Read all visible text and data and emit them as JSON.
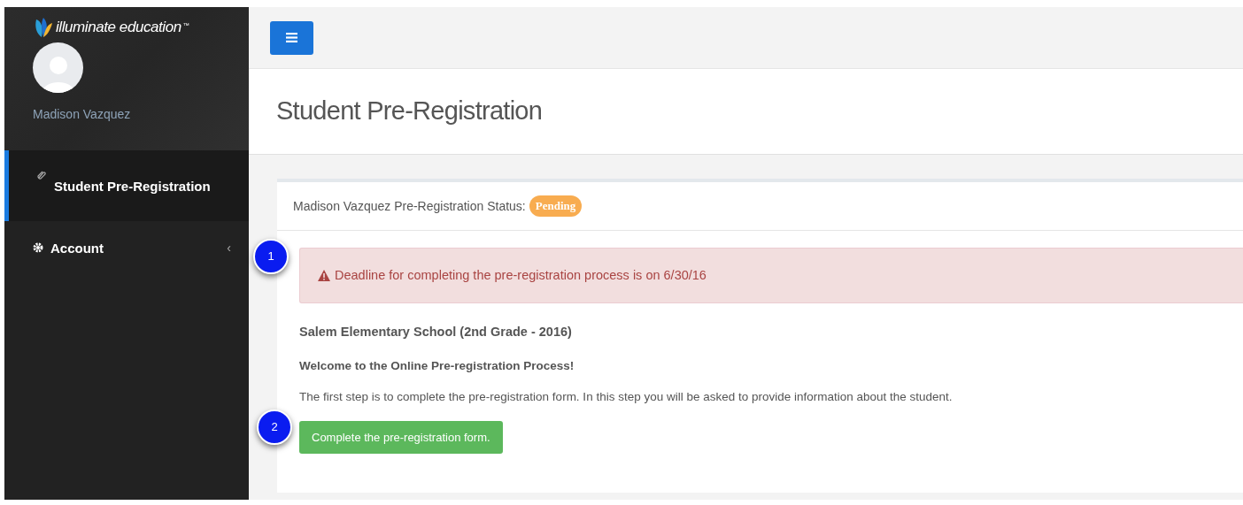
{
  "sidebar": {
    "logo_text": "illuminate education",
    "logo_mark": "™",
    "user_name": "Madison Vazquez",
    "items": [
      {
        "label": "Student Pre-Registration",
        "kind": "link",
        "selected": true
      },
      {
        "label": "Account",
        "kind": "submenu",
        "selected": false,
        "expanded": false,
        "caret": "‹"
      }
    ]
  },
  "page": {
    "title": "Student Pre-Registration"
  },
  "card": {
    "status_label": "Madison Vazquez Pre-Registration Status:",
    "status_badge": "Pending",
    "alert": "Deadline for completing the pre-registration process is on 6/30/16",
    "school": "Salem Elementary School (2nd Grade - 2016)",
    "welcome": "Welcome to the Online Pre-registration Process!",
    "intro": "The first step is to complete the pre-registration form. In this step you will be asked to provide information about the student.",
    "button": "Complete the pre-registration form."
  },
  "callouts": [
    "1",
    "2"
  ]
}
